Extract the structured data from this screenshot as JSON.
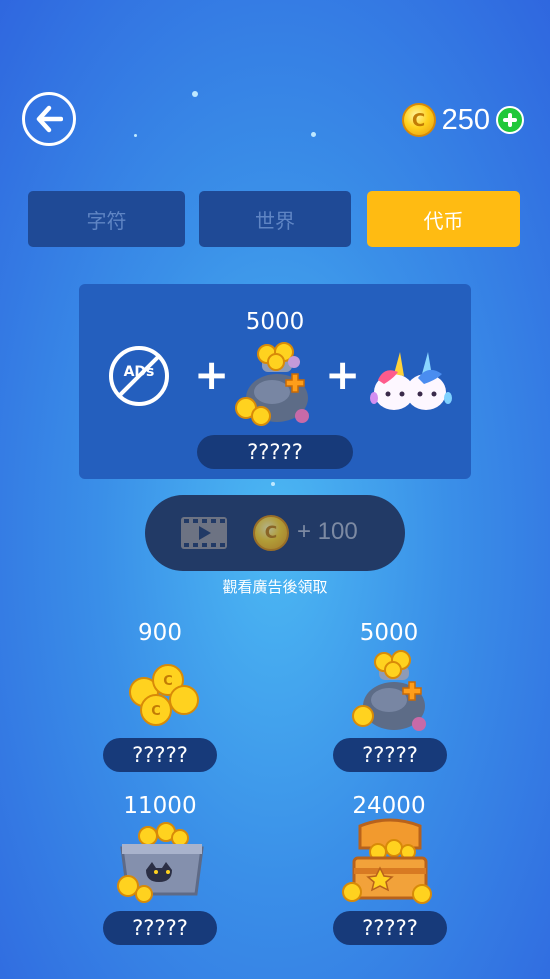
{
  "header": {
    "balance": "250",
    "back_icon": "back-arrow-icon",
    "add_icon": "plus-icon"
  },
  "tabs": [
    {
      "label": "字符",
      "active": false
    },
    {
      "label": "世界",
      "active": false
    },
    {
      "label": "代币",
      "active": true
    }
  ],
  "bundle": {
    "amount": "5000",
    "price": "?????",
    "icons": [
      "no-ads-icon",
      "coin-bag-icon",
      "unicorn-characters-icon"
    ]
  },
  "video_reward": {
    "label": "+ 100",
    "note": "觀看廣告後領取",
    "icon": "film-play-icon"
  },
  "packs": [
    {
      "amount": "900",
      "price": "?????",
      "icon": "coin-pile-icon"
    },
    {
      "amount": "5000",
      "price": "?????",
      "icon": "coin-bag-icon"
    },
    {
      "amount": "11000",
      "price": "?????",
      "icon": "coin-crate-icon"
    },
    {
      "amount": "24000",
      "price": "?????",
      "icon": "treasure-chest-icon"
    }
  ],
  "colors": {
    "active_tab": "#ffbb12",
    "inactive_tab": "#1f4a96",
    "panel": "#245fbe",
    "price_pill": "#173a7a",
    "plus_green": "#20c83a"
  }
}
